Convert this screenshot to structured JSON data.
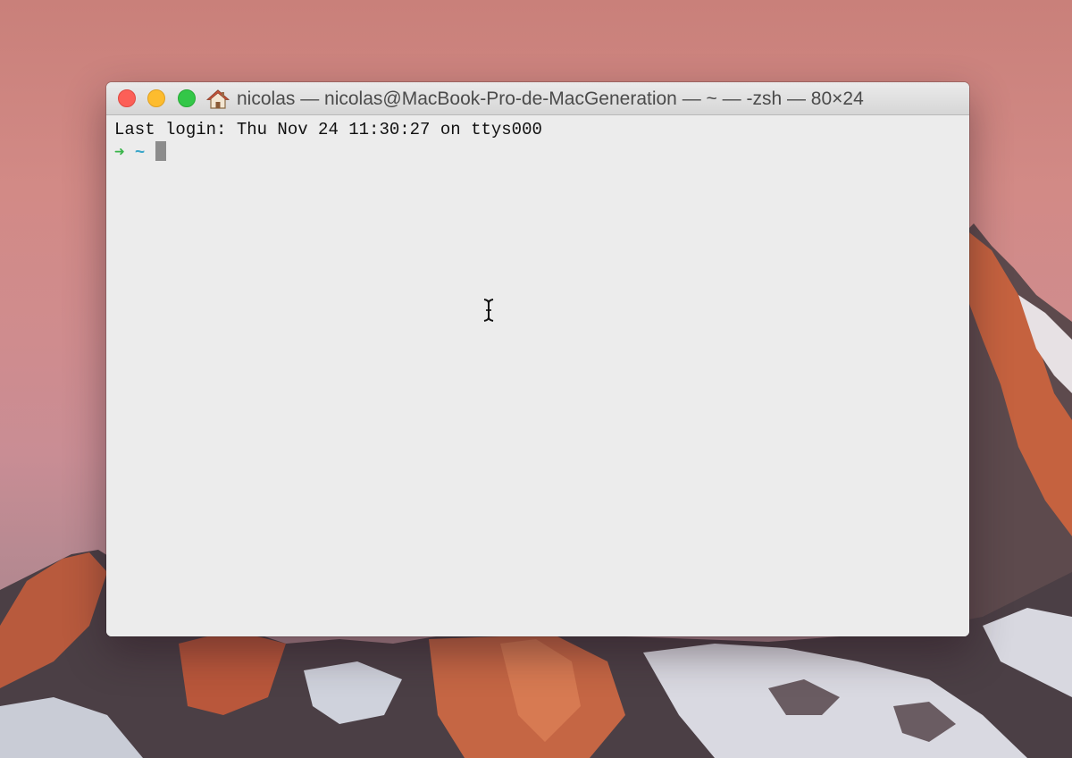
{
  "window": {
    "title": "nicolas — nicolas@MacBook-Pro-de-MacGeneration — ~ — -zsh — 80×24",
    "title_icon": "home-icon"
  },
  "terminal": {
    "last_login": "Last login: Thu Nov 24 11:30:27 on ttys000",
    "prompt_arrow": "➜",
    "prompt_dir": "~"
  },
  "colors": {
    "close": "#fc5f57",
    "minimize": "#fdbc2e",
    "zoom": "#33c748",
    "prompt_arrow": "#39b54a",
    "prompt_dir": "#3aa6c9",
    "terminal_bg": "#ececec"
  }
}
